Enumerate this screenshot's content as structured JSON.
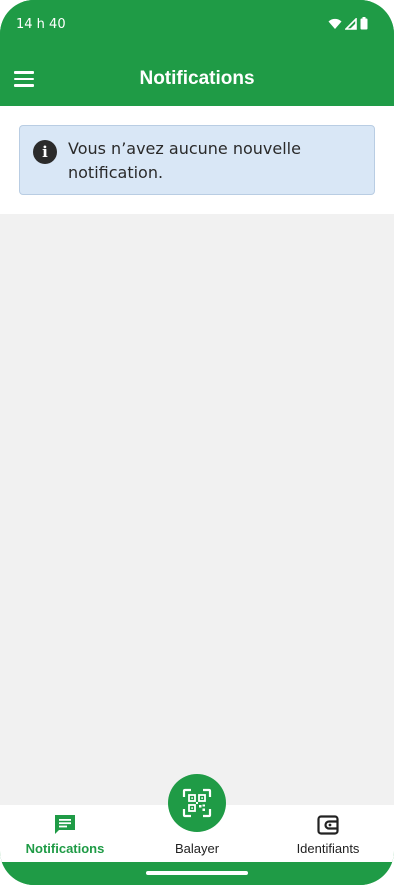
{
  "status_bar": {
    "time": "14 h 40",
    "icons": [
      "wifi-icon",
      "signal-icon",
      "battery-icon"
    ]
  },
  "app_bar": {
    "title": "Notifications",
    "menu_icon": "hamburger-menu-icon"
  },
  "info_alert": {
    "icon": "info-icon",
    "icon_glyph": "i",
    "message": "Vous n’avez aucune nouvelle notification."
  },
  "bottom_nav": {
    "items": [
      {
        "label": "Notifications",
        "icon": "message-icon",
        "active": true
      },
      {
        "label": "Balayer",
        "icon": "qr-scan-icon",
        "active": false
      },
      {
        "label": "Identifiants",
        "icon": "wallet-icon",
        "active": false
      }
    ]
  },
  "colors": {
    "brand_green": "#1f9b46",
    "alert_background": "#d9e7f6",
    "content_background": "#f1f1f1"
  }
}
